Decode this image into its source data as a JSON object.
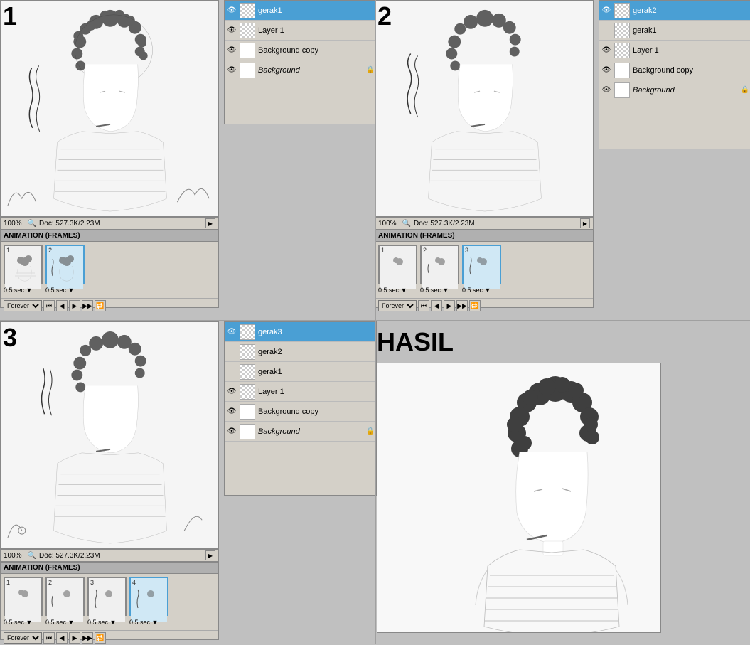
{
  "sections": {
    "s1": {
      "number": "1",
      "canvas": {
        "zoom": "100%",
        "doc_info": "Doc: 527.3K/2.23M"
      },
      "layers": [
        {
          "name": "gerak1",
          "selected": true,
          "thumb": "checker",
          "eye": true
        },
        {
          "name": "Layer 1",
          "selected": false,
          "thumb": "checker",
          "eye": true
        },
        {
          "name": "Background copy",
          "selected": false,
          "thumb": "filled",
          "eye": true
        },
        {
          "name": "Background",
          "selected": false,
          "thumb": "filled",
          "eye": true,
          "italic": true,
          "lock": true
        }
      ],
      "anim": {
        "title": "ANIMATION (FRAMES)",
        "frames": [
          {
            "num": "1",
            "time": "0.5 sec.▼",
            "selected": false
          },
          {
            "num": "2",
            "time": "0.5 sec.▼",
            "selected": true
          }
        ],
        "loop": "Forever"
      }
    },
    "s2": {
      "number": "2",
      "canvas": {
        "zoom": "100%",
        "doc_info": "Doc: 527.3K/2.23M"
      },
      "layers": [
        {
          "name": "gerak2",
          "selected": true,
          "thumb": "checker",
          "eye": true
        },
        {
          "name": "gerak1",
          "selected": false,
          "thumb": "checker",
          "eye": false
        },
        {
          "name": "Layer 1",
          "selected": false,
          "thumb": "checker",
          "eye": true
        },
        {
          "name": "Background copy",
          "selected": false,
          "thumb": "filled",
          "eye": true
        },
        {
          "name": "Background",
          "selected": false,
          "thumb": "filled",
          "eye": true,
          "italic": true,
          "lock": true
        }
      ],
      "anim": {
        "title": "ANIMATION (FRAMES)",
        "frames": [
          {
            "num": "1",
            "time": "0.5 sec.▼",
            "selected": false
          },
          {
            "num": "2",
            "time": "0.5 sec.▼",
            "selected": false
          },
          {
            "num": "3",
            "time": "0.5 sec.▼",
            "selected": true
          }
        ],
        "loop": "Forever"
      }
    },
    "s3": {
      "number": "3",
      "canvas": {
        "zoom": "100%",
        "doc_info": "Doc: 527.3K/2.23M"
      },
      "layers": [
        {
          "name": "gerak3",
          "selected": true,
          "thumb": "checker",
          "eye": true
        },
        {
          "name": "gerak2",
          "selected": false,
          "thumb": "checker",
          "eye": false
        },
        {
          "name": "gerak1",
          "selected": false,
          "thumb": "checker",
          "eye": false
        },
        {
          "name": "Layer 1",
          "selected": false,
          "thumb": "checker",
          "eye": true
        },
        {
          "name": "Background copy",
          "selected": false,
          "thumb": "filled",
          "eye": true
        },
        {
          "name": "Background",
          "selected": false,
          "thumb": "filled",
          "eye": true,
          "italic": true,
          "lock": true
        }
      ],
      "anim": {
        "title": "ANIMATION (FRAMES)",
        "frames": [
          {
            "num": "1",
            "time": "0.5 sec.▼",
            "selected": false
          },
          {
            "num": "2",
            "time": "0.5 sec.▼",
            "selected": false
          },
          {
            "num": "3",
            "time": "0.5 sec.▼",
            "selected": false
          },
          {
            "num": "4",
            "time": "0.5 sec.▼",
            "selected": true
          }
        ],
        "loop": "Forever"
      }
    },
    "hasil": {
      "title": "HASIL"
    }
  },
  "colors": {
    "selected_layer": "#4a9fd4",
    "panel_bg": "#d4d0c8",
    "canvas_bg": "#f0f0f0"
  }
}
